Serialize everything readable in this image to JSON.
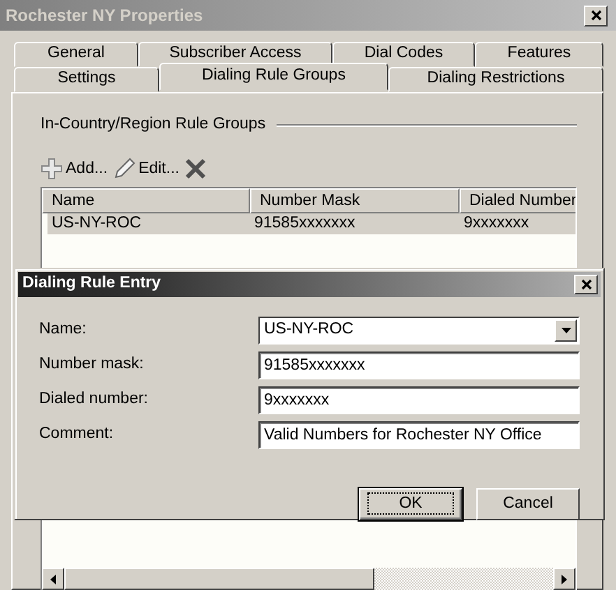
{
  "window": {
    "title": "Rochester NY Properties"
  },
  "tab_rows": [
    {
      "tabs": [
        {
          "label": "General",
          "selected": false
        },
        {
          "label": "Subscriber Access",
          "selected": false
        },
        {
          "label": "Dial Codes",
          "selected": false
        },
        {
          "label": "Features",
          "selected": false
        }
      ]
    },
    {
      "tabs": [
        {
          "label": "Settings",
          "selected": false
        },
        {
          "label": "Dialing Rule Groups",
          "selected": true
        },
        {
          "label": "Dialing Restrictions",
          "selected": false
        }
      ]
    }
  ],
  "group": {
    "label": "In-Country/Region Rule Groups"
  },
  "toolbar": [
    {
      "kind": "add",
      "label": "Add..."
    },
    {
      "kind": "edit",
      "label": "Edit..."
    },
    {
      "kind": "delete"
    }
  ],
  "table": {
    "columns": [
      "Name",
      "Number Mask",
      "Dialed Number"
    ],
    "rows": [
      {
        "cells": [
          "US-NY-ROC",
          "91585xxxxxxx",
          "9xxxxxxx"
        ],
        "selected": true
      }
    ]
  },
  "dialog": {
    "title": "Dialing Rule Entry",
    "fields": [
      {
        "kind": "combo",
        "label": "Name:",
        "value": "US-NY-ROC"
      },
      {
        "kind": "text",
        "label": "Number mask:",
        "value": "91585xxxxxxx"
      },
      {
        "kind": "text",
        "label": "Dialed number:",
        "value": "9xxxxxxx"
      },
      {
        "kind": "text",
        "label": "Comment:",
        "value": "Valid Numbers for Rochester NY Office"
      }
    ],
    "buttons": [
      {
        "label": "OK",
        "default": true
      },
      {
        "label": "Cancel",
        "default": false
      }
    ]
  }
}
